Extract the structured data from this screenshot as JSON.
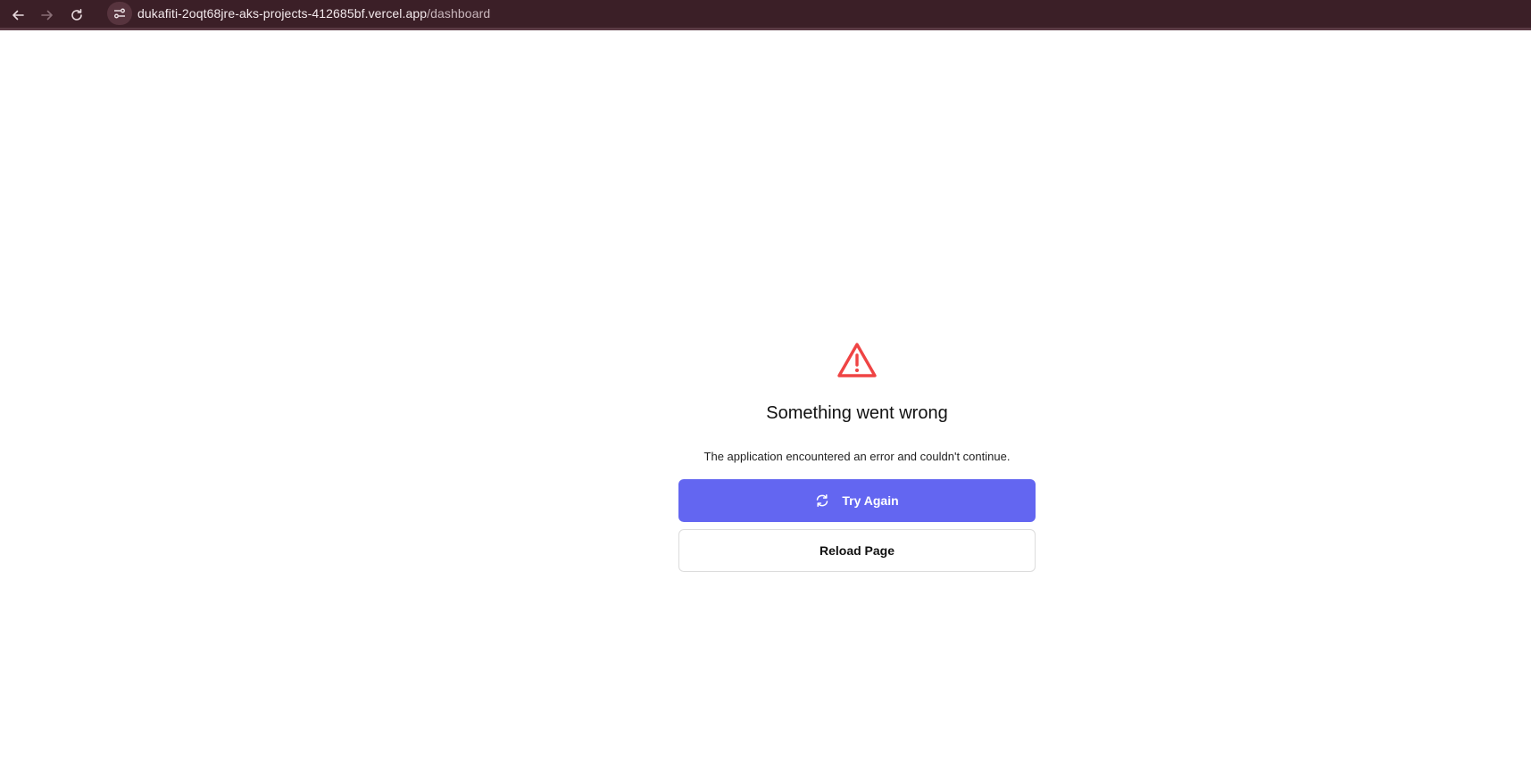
{
  "browser": {
    "url_host": "dukafiti-2oqt68jre-aks-projects-412685bf.vercel.app",
    "url_path": "/dashboard",
    "icons": {
      "back": "arrow-left-icon",
      "forward": "arrow-right-icon",
      "reload": "reload-icon",
      "site_info": "site-settings-icon"
    },
    "colors": {
      "bar": "#3b1f27",
      "url_text": "#f3e9ec"
    }
  },
  "error": {
    "icon": "warning-triangle-icon",
    "icon_color": "#ef4444",
    "title": "Something went wrong",
    "message": "The application encountered an error and couldn't continue.",
    "try_again_label": "Try Again",
    "try_again_icon": "refresh-icon",
    "reload_label": "Reload Page",
    "colors": {
      "primary": "#6366f1",
      "secondary_border": "#dcdcdc"
    }
  }
}
